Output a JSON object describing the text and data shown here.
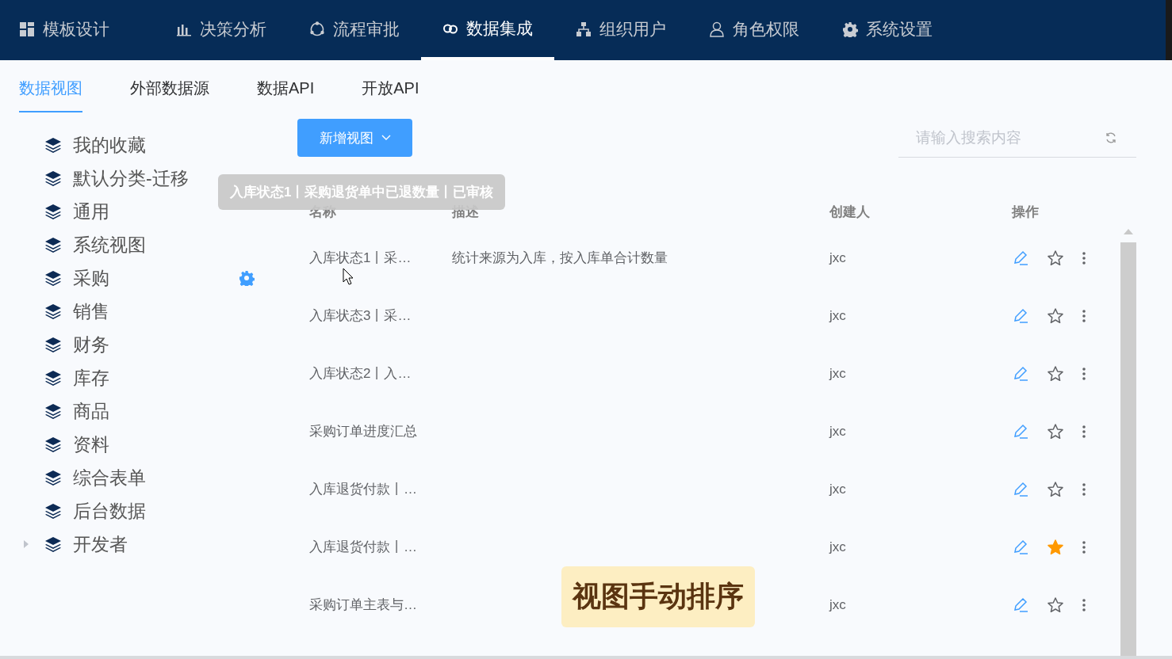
{
  "nav": [
    {
      "label": "模板设计",
      "selected": false
    },
    {
      "label": "决策分析",
      "selected": false
    },
    {
      "label": "流程审批",
      "selected": false
    },
    {
      "label": "数据集成",
      "selected": true
    },
    {
      "label": "组织用户",
      "selected": false
    },
    {
      "label": "角色权限",
      "selected": false
    },
    {
      "label": "系统设置",
      "selected": false
    }
  ],
  "tabs": [
    {
      "label": "数据视图",
      "selected": true
    },
    {
      "label": "外部数据源",
      "selected": false
    },
    {
      "label": "数据API",
      "selected": false
    },
    {
      "label": "开放API",
      "selected": false
    }
  ],
  "sidebar": {
    "items": [
      {
        "label": "我的收藏",
        "kind": "leaf",
        "hovered": false
      },
      {
        "label": "默认分类-迁移",
        "kind": "leaf",
        "hovered": false
      },
      {
        "label": "通用",
        "kind": "leaf",
        "hovered": false
      },
      {
        "label": "系统视图",
        "kind": "leaf",
        "hovered": false
      },
      {
        "label": "采购",
        "kind": "leaf",
        "hovered": true
      },
      {
        "label": "销售",
        "kind": "leaf",
        "hovered": false
      },
      {
        "label": "财务",
        "kind": "leaf",
        "hovered": false
      },
      {
        "label": "库存",
        "kind": "leaf",
        "hovered": false
      },
      {
        "label": "商品",
        "kind": "leaf",
        "hovered": false
      },
      {
        "label": "资料",
        "kind": "leaf",
        "hovered": false
      },
      {
        "label": "综合表单",
        "kind": "leaf",
        "hovered": false
      },
      {
        "label": "后台数据",
        "kind": "leaf",
        "hovered": false
      },
      {
        "label": "开发者",
        "kind": "group",
        "hovered": false
      }
    ]
  },
  "toolbar": {
    "new_button": "新增视图",
    "search": {
      "placeholder": "请输入搜索内容"
    }
  },
  "tooltip": "入库状态1丨采购退货单中已退数量丨已审核",
  "table": {
    "columns": [
      "名称",
      "描述",
      "创建人",
      "操作"
    ],
    "rows": [
      {
        "name": "入库状态1丨采…",
        "description": "统计来源为入库，按入库单合计数量",
        "creator": "jxc",
        "starred": false
      },
      {
        "name": "入库状态3丨采…",
        "creator": "jxc",
        "starred": false
      },
      {
        "name": "入库状态2丨入…",
        "creator": "jxc",
        "starred": false
      },
      {
        "name": "采购订单进度汇总",
        "creator": "jxc",
        "starred": false
      },
      {
        "name": "入库退货付款丨…",
        "creator": "jxc",
        "starred": false
      },
      {
        "name": "入库退货付款丨…",
        "creator": "jxc",
        "starred": true
      },
      {
        "name": "采购订单主表与…",
        "creator": "jxc",
        "starred": false
      }
    ]
  },
  "caption": "视图手动排序"
}
